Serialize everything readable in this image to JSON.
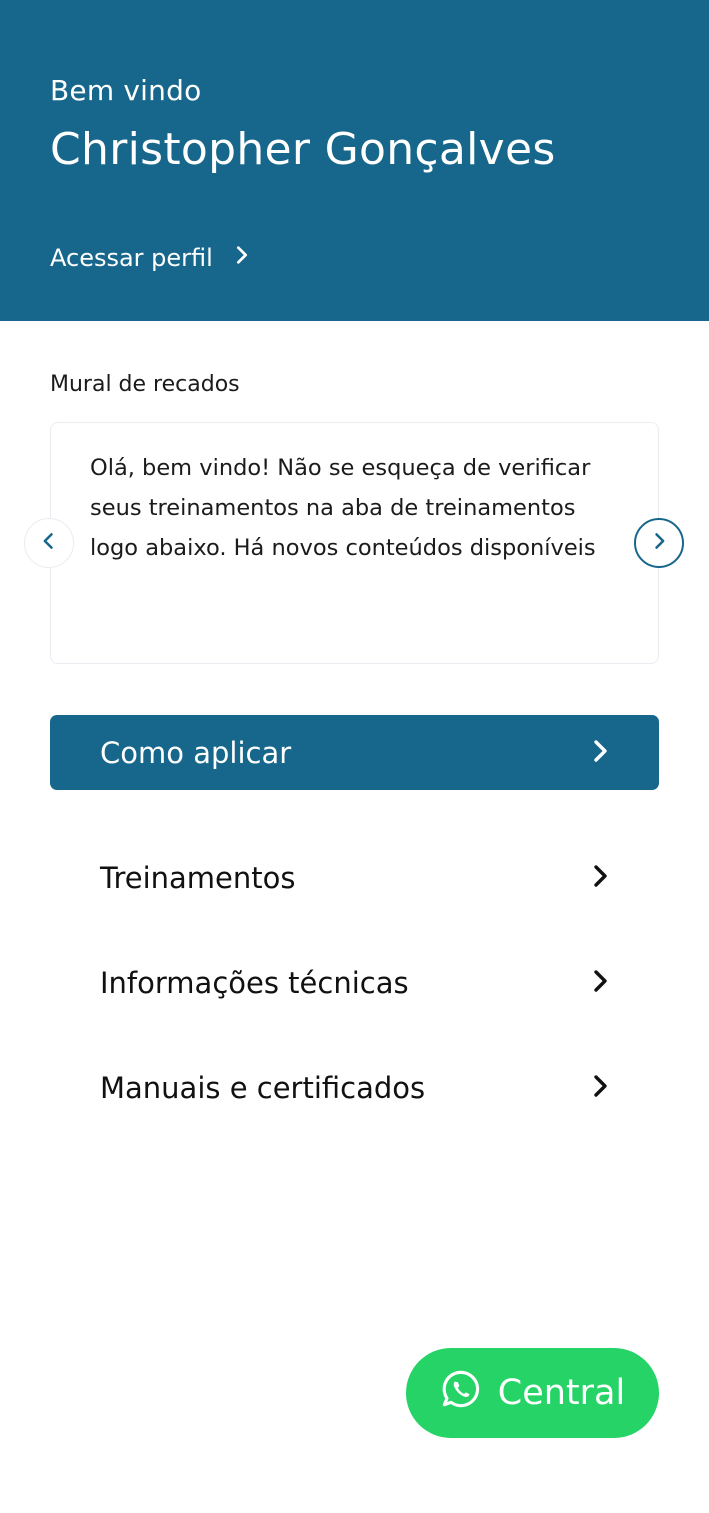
{
  "header": {
    "greeting": "Bem vindo",
    "user_name": "Christopher Gonçalves",
    "profile_link": "Acessar perfil"
  },
  "mural": {
    "title": "Mural de recados",
    "message": "Olá, bem vindo! Não se esqueça de verificar seus treinamentos na aba de treinamentos logo abaixo. Há novos conteúdos disponíveis",
    "prev_icon": "chevron-left-icon",
    "next_icon": "chevron-right-icon"
  },
  "menu": {
    "items": [
      {
        "label": "Como aplicar",
        "highlighted": true
      },
      {
        "label": "Treinamentos",
        "highlighted": false
      },
      {
        "label": "Informações técnicas",
        "highlighted": false
      },
      {
        "label": "Manuais e certificados",
        "highlighted": false
      }
    ]
  },
  "central_button": {
    "label": "Central",
    "icon": "whatsapp-icon"
  },
  "colors": {
    "primary": "#17668b",
    "whatsapp": "#25d366",
    "text": "#111111"
  }
}
